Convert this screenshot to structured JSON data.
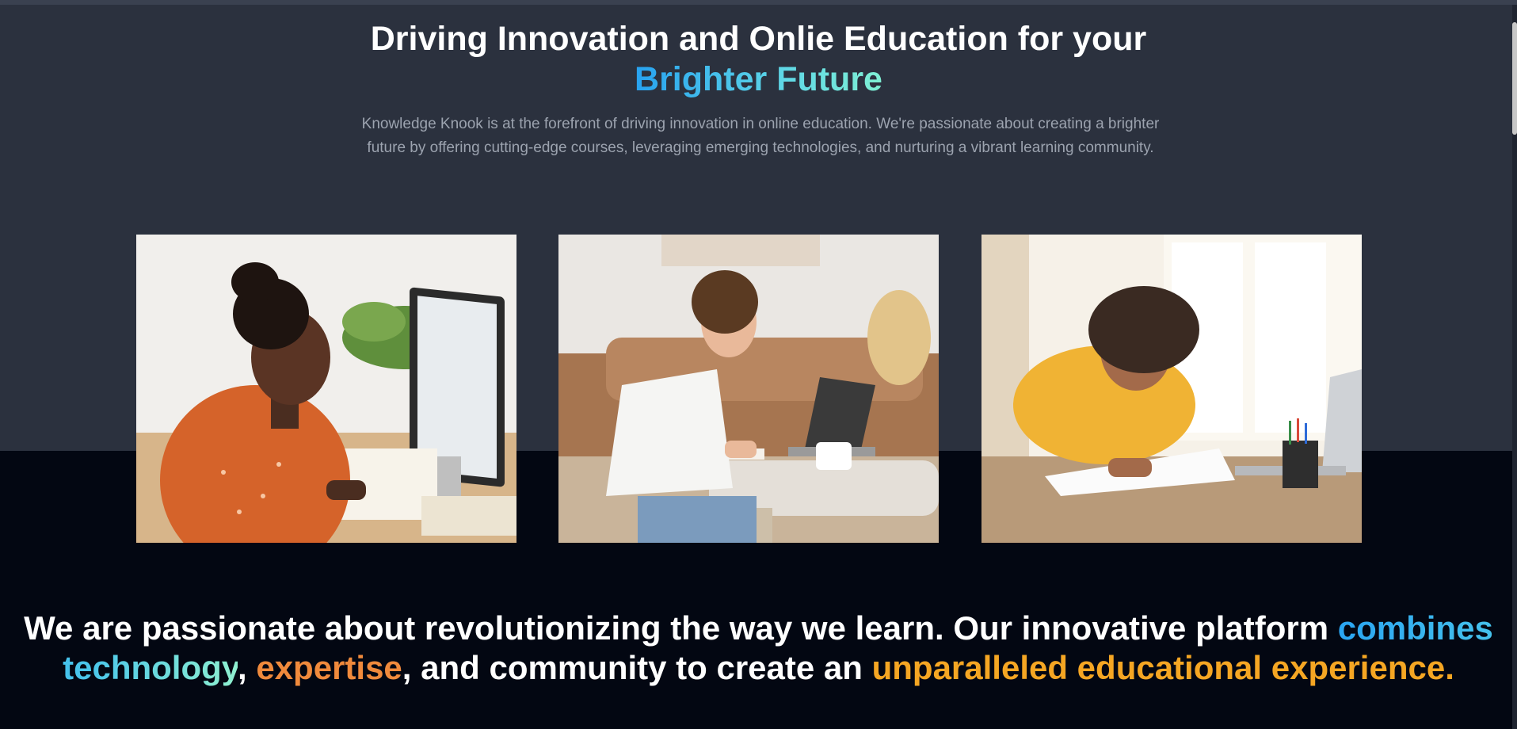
{
  "hero": {
    "title_line1": "Driving Innovation and Onlie Education for your",
    "title_highlight": "Brighter Future",
    "description": "Knowledge Knook is at the forefront of driving innovation in online education. We're passionate about creating a brighter future by offering cutting-edge courses, leveraging emerging technologies, and nurturing a vibrant learning community."
  },
  "photos": [
    {
      "icon": "woman-at-desktop-computer-photo"
    },
    {
      "icon": "woman-writing-with-laptop-photo"
    },
    {
      "icon": "woman-writing-at-table-photo"
    }
  ],
  "statement": {
    "part1": "We are passionate about revolutionizing the way we learn. Our innovative platform ",
    "tech": "combines technology",
    "comma1": ", ",
    "expertise": "expertise",
    "part2": ", and community to create an ",
    "experience": "unparalleled educational experience."
  },
  "colors": {
    "hero_background": "#2b313e",
    "page_background": "#030712",
    "accent_blue": "#27a2f0",
    "accent_teal": "#7ff0d4",
    "accent_orange": "#f08a3c",
    "accent_gold": "#f5a623"
  }
}
